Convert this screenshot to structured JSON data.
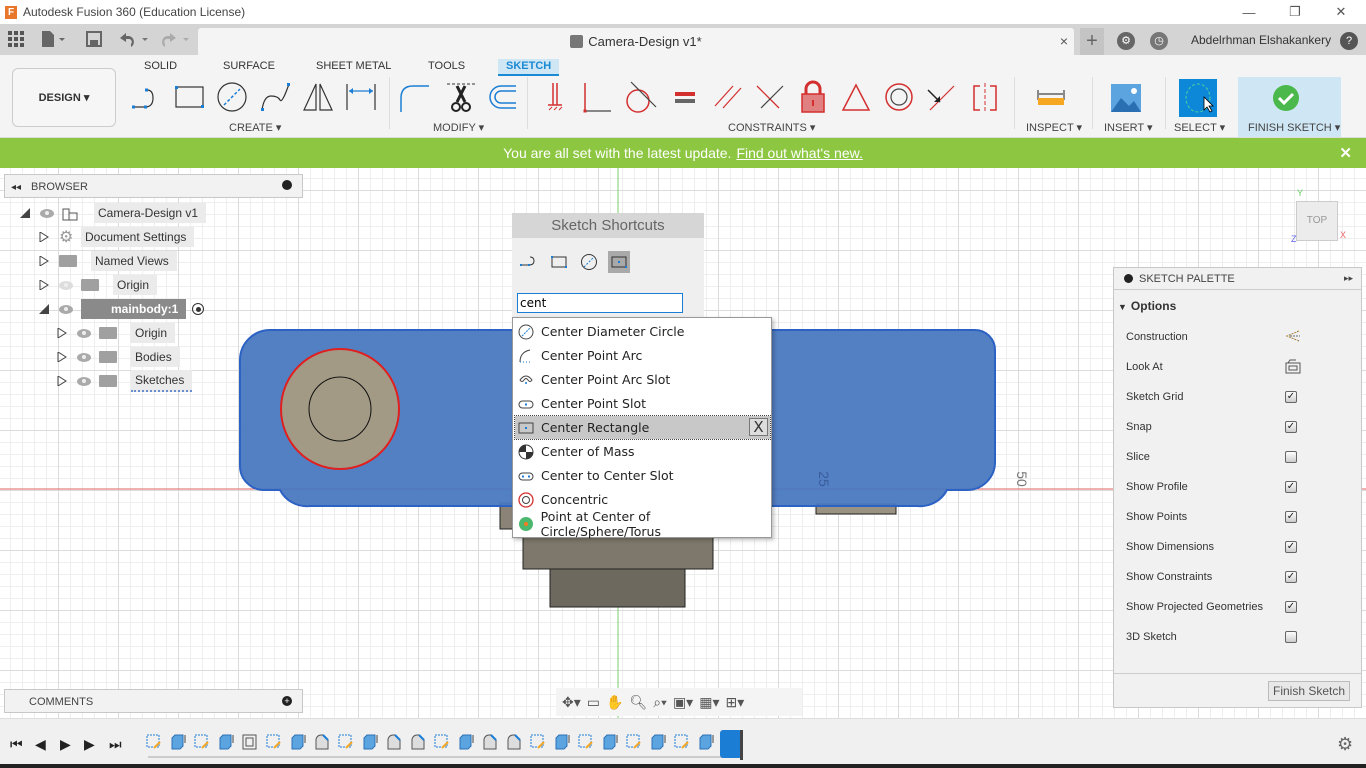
{
  "window": {
    "title": "Autodesk Fusion 360 (Education License)",
    "app_icon": "F"
  },
  "quick_access": {
    "apps_icon": "grid-icon",
    "file_icon": "file-icon",
    "save_icon": "save-icon",
    "undo_icon": "undo-icon",
    "redo_icon": "redo-icon"
  },
  "document_tab": {
    "name": "Camera-Design v1*",
    "close": "×"
  },
  "header": {
    "new_tab": "+",
    "user": "Abdelrhman Elshakankery",
    "help": "?"
  },
  "ribbon": {
    "workspace": "DESIGN ▾",
    "tabs": [
      {
        "label": "SOLID"
      },
      {
        "label": "SURFACE"
      },
      {
        "label": "SHEET METAL"
      },
      {
        "label": "TOOLS"
      },
      {
        "label": "SKETCH",
        "active": true
      }
    ],
    "groups": {
      "create": "CREATE ▾",
      "modify": "MODIFY ▾",
      "constraints": "CONSTRAINTS ▾",
      "inspect": "INSPECT ▾",
      "insert": "INSERT ▾",
      "select": "SELECT ▾",
      "finish": "FINISH SKETCH ▾"
    }
  },
  "banner": {
    "text": "You are all set with the latest update.",
    "link": "Find out what's new.",
    "close": "✕"
  },
  "browser": {
    "title": "BROWSER",
    "items": [
      {
        "label": "Camera-Design v1"
      },
      {
        "label": "Document Settings"
      },
      {
        "label": "Named Views"
      },
      {
        "label": "Origin"
      },
      {
        "label": "mainbody:1"
      },
      {
        "label": "Origin"
      },
      {
        "label": "Bodies"
      },
      {
        "label": "Sketches"
      }
    ]
  },
  "comments": {
    "title": "COMMENTS"
  },
  "viewcube": {
    "face": "TOP",
    "x": "X",
    "y": "Y",
    "z": "Z"
  },
  "canvas": {
    "dim_25": "25",
    "dim_50": "50"
  },
  "shortcuts": {
    "title": "Sketch Shortcuts",
    "search_value": "cent",
    "results": [
      {
        "label": "Center Diameter Circle"
      },
      {
        "label": "Center Point Arc"
      },
      {
        "label": "Center Point Arc Slot"
      },
      {
        "label": "Center Point Slot"
      },
      {
        "label": "Center Rectangle",
        "selected": true
      },
      {
        "label": "Center of Mass"
      },
      {
        "label": "Center to Center Slot"
      },
      {
        "label": "Concentric"
      },
      {
        "label": "Point at Center of Circle/Sphere/Torus"
      }
    ],
    "remove": "X"
  },
  "palette": {
    "title": "SKETCH PALETTE",
    "section": "Options",
    "options": [
      {
        "label": "Construction",
        "type": "icon"
      },
      {
        "label": "Look At",
        "type": "icon"
      },
      {
        "label": "Sketch Grid",
        "checked": true
      },
      {
        "label": "Snap",
        "checked": true
      },
      {
        "label": "Slice",
        "checked": false
      },
      {
        "label": "Show Profile",
        "checked": true
      },
      {
        "label": "Show Points",
        "checked": true
      },
      {
        "label": "Show Dimensions",
        "checked": true
      },
      {
        "label": "Show Constraints",
        "checked": true
      },
      {
        "label": "Show Projected Geometries",
        "checked": true
      },
      {
        "label": "3D Sketch",
        "checked": false
      }
    ],
    "finish_button": "Finish Sketch"
  },
  "colors": {
    "accent": "#1a8ad4",
    "banner": "#8dc641",
    "body": "#4a78c0",
    "constraint_red": "#d32f2f"
  }
}
